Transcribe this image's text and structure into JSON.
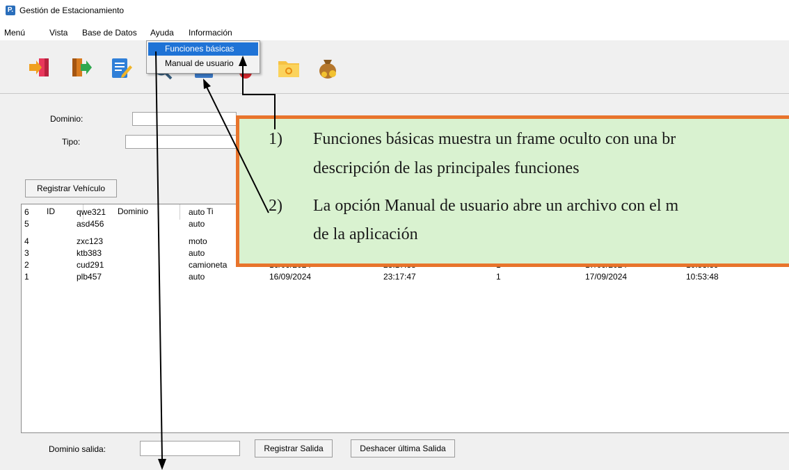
{
  "window": {
    "title": "Gestión de Estacionamiento",
    "app_icon_text": "P."
  },
  "menubar": {
    "items": [
      "Menú",
      "Vista",
      "Base de Datos",
      "Ayuda",
      "Información"
    ]
  },
  "toolbar": {
    "icons": [
      "enter-icon",
      "exit-icon",
      "edit-icon",
      "search-icon",
      "list-icon",
      "delete-icon",
      "folder-icon",
      "money-bag-icon"
    ]
  },
  "ayuda_menu": {
    "items": [
      "Funciones básicas",
      "Manual de usuario"
    ],
    "selected": "Funciones básicas"
  },
  "form": {
    "dominio_label": "Dominio:",
    "dominio_value": "",
    "tipo_label": "Tipo:",
    "tipo_value": "",
    "registrar_button": "Registrar Vehículo"
  },
  "table": {
    "headers": [
      "ID",
      "Dominio",
      "Ti"
    ],
    "rows": [
      {
        "id": "6",
        "dominio": "qwe321",
        "tipo": "auto",
        "fecha_in": "",
        "hora_in": "",
        "n": "",
        "fecha_out": "",
        "hora_out": ""
      },
      {
        "id": "5",
        "dominio": "asd456",
        "tipo": "auto",
        "fecha_in": "",
        "hora_in": "",
        "n": "",
        "fecha_out": "",
        "hora_out": ""
      },
      {
        "id": "4",
        "dominio": "zxc123",
        "tipo": "moto",
        "fecha_in": "",
        "hora_in": "",
        "n": "",
        "fecha_out": "",
        "hora_out": ""
      },
      {
        "id": "3",
        "dominio": "ktb383",
        "tipo": "auto",
        "fecha_in": "",
        "hora_in": "",
        "n": "",
        "fecha_out": "",
        "hora_out": ""
      },
      {
        "id": "2",
        "dominio": "cud291",
        "tipo": "camioneta",
        "fecha_in": "16/09/2024",
        "hora_in": "23:17:38",
        "n": "1",
        "fecha_out": "17/09/2024",
        "hora_out": "10:53:39"
      },
      {
        "id": "1",
        "dominio": "plb457",
        "tipo": "auto",
        "fecha_in": "16/09/2024",
        "hora_in": "23:17:47",
        "n": "1",
        "fecha_out": "17/09/2024",
        "hora_out": "10:53:48"
      }
    ]
  },
  "footer": {
    "dominio_salida_label": "Dominio salida:",
    "dominio_salida_value": "",
    "registrar_salida_button": "Registrar Salida",
    "deshacer_button": "Deshacer última Salida"
  },
  "callout": {
    "item1_num": "1)",
    "item1_line1": "Funciones básicas muestra un frame oculto con una br",
    "item1_line2": "descripción de las principales funciones",
    "item2_num": "2)",
    "item2_line1": "La opción Manual de usuario abre un archivo con el m",
    "item2_line2": "de la aplicación",
    "border_color": "#e8742c",
    "fill_color": "#d9f2d0"
  }
}
